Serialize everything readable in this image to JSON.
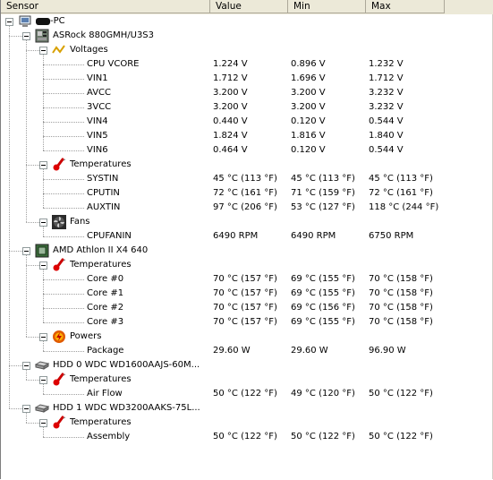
{
  "columns": [
    "Sensor",
    "Value",
    "Min",
    "Max"
  ],
  "rows": [
    {
      "level": 0,
      "expander": true,
      "icon": "computer-icon",
      "label": "-PC",
      "redacted": true,
      "value": "",
      "min": "",
      "max": ""
    },
    {
      "level": 1,
      "expander": true,
      "icon": "motherboard-icon",
      "label": "ASRock 880GMH/U3S3",
      "value": "",
      "min": "",
      "max": ""
    },
    {
      "level": 2,
      "expander": true,
      "icon": "voltage-icon",
      "label": "Voltages",
      "value": "",
      "min": "",
      "max": ""
    },
    {
      "level": 3,
      "label": "CPU VCORE",
      "value": "1.224 V",
      "min": "0.896 V",
      "max": "1.232 V"
    },
    {
      "level": 3,
      "label": "VIN1",
      "value": "1.712 V",
      "min": "1.696 V",
      "max": "1.712 V"
    },
    {
      "level": 3,
      "label": "AVCC",
      "value": "3.200 V",
      "min": "3.200 V",
      "max": "3.232 V"
    },
    {
      "level": 3,
      "label": "3VCC",
      "value": "3.200 V",
      "min": "3.200 V",
      "max": "3.232 V"
    },
    {
      "level": 3,
      "label": "VIN4",
      "value": "0.440 V",
      "min": "0.120 V",
      "max": "0.544 V"
    },
    {
      "level": 3,
      "label": "VIN5",
      "value": "1.824 V",
      "min": "1.816 V",
      "max": "1.840 V"
    },
    {
      "level": 3,
      "label": "VIN6",
      "value": "0.464 V",
      "min": "0.120 V",
      "max": "0.544 V"
    },
    {
      "level": 2,
      "expander": true,
      "icon": "thermometer-icon",
      "label": "Temperatures",
      "value": "",
      "min": "",
      "max": ""
    },
    {
      "level": 3,
      "label": "SYSTIN",
      "value": "45 °C  (113 °F)",
      "min": "45 °C  (113 °F)",
      "max": "45 °C  (113 °F)"
    },
    {
      "level": 3,
      "label": "CPUTIN",
      "value": "72 °C  (161 °F)",
      "min": "71 °C  (159 °F)",
      "max": "72 °C  (161 °F)"
    },
    {
      "level": 3,
      "label": "AUXTIN",
      "value": "97 °C  (206 °F)",
      "min": "53 °C  (127 °F)",
      "max": "118 °C  (244 °F)"
    },
    {
      "level": 2,
      "expander": true,
      "icon": "fan-icon",
      "label": "Fans",
      "value": "",
      "min": "",
      "max": ""
    },
    {
      "level": 3,
      "label": "CPUFANIN",
      "value": "6490 RPM",
      "min": "6490 RPM",
      "max": "6750 RPM"
    },
    {
      "level": 1,
      "expander": true,
      "icon": "cpu-icon",
      "label": "AMD Athlon II X4 640",
      "value": "",
      "min": "",
      "max": ""
    },
    {
      "level": 2,
      "expander": true,
      "icon": "thermometer-icon",
      "label": "Temperatures",
      "value": "",
      "min": "",
      "max": ""
    },
    {
      "level": 3,
      "label": "Core #0",
      "value": "70 °C  (157 °F)",
      "min": "69 °C  (155 °F)",
      "max": "70 °C  (158 °F)"
    },
    {
      "level": 3,
      "label": "Core #1",
      "value": "70 °C  (157 °F)",
      "min": "69 °C  (155 °F)",
      "max": "70 °C  (158 °F)"
    },
    {
      "level": 3,
      "label": "Core #2",
      "value": "70 °C  (157 °F)",
      "min": "69 °C  (156 °F)",
      "max": "70 °C  (158 °F)"
    },
    {
      "level": 3,
      "label": "Core #3",
      "value": "70 °C  (157 °F)",
      "min": "69 °C  (155 °F)",
      "max": "70 °C  (158 °F)"
    },
    {
      "level": 2,
      "expander": true,
      "icon": "power-icon",
      "label": "Powers",
      "value": "",
      "min": "",
      "max": ""
    },
    {
      "level": 3,
      "label": "Package",
      "value": "29.60 W",
      "min": "29.60 W",
      "max": "96.90 W"
    },
    {
      "level": 1,
      "expander": true,
      "icon": "hdd-icon",
      "label": "HDD 0 WDC WD1600AAJS-60M...",
      "value": "",
      "min": "",
      "max": ""
    },
    {
      "level": 2,
      "expander": true,
      "icon": "thermometer-icon",
      "label": "Temperatures",
      "value": "",
      "min": "",
      "max": ""
    },
    {
      "level": 3,
      "label": "Air Flow",
      "value": "50 °C  (122 °F)",
      "min": "49 °C  (120 °F)",
      "max": "50 °C  (122 °F)"
    },
    {
      "level": 1,
      "expander": true,
      "icon": "hdd-icon",
      "label": "HDD 1 WDC WD3200AAKS-75L...",
      "value": "",
      "min": "",
      "max": ""
    },
    {
      "level": 2,
      "expander": true,
      "icon": "thermometer-icon",
      "label": "Temperatures",
      "value": "",
      "min": "",
      "max": ""
    },
    {
      "level": 3,
      "label": "Assembly",
      "value": "50 °C  (122 °F)",
      "min": "50 °C  (122 °F)",
      "max": "50 °C  (122 °F)"
    }
  ]
}
